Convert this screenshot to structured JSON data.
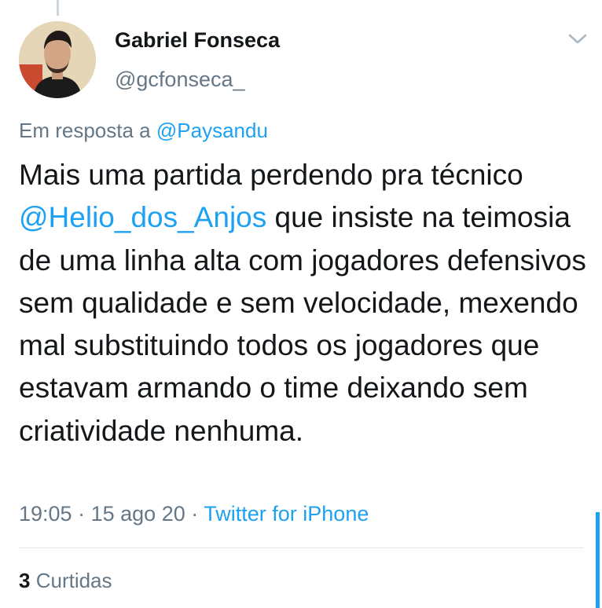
{
  "tweet": {
    "author": {
      "name": "Gabriel Fonseca",
      "handle": "@gcfonseca_"
    },
    "reply": {
      "prefix": "Em resposta a",
      "mention": "@Paysandu"
    },
    "body": {
      "part1": "Mais uma partida perdendo pra técnico",
      "mention": "@Helio_dos_Anjos",
      "part2": "que insiste na teimosia de uma linha alta com jogadores defensivos sem qualidade e sem velocidade, mexendo mal substituindo todos os jogadores que estavam armando o time deixando sem criatividade nenhuma."
    },
    "meta": {
      "time": "19:05",
      "separator": "·",
      "date": "15 ago 20",
      "source": "Twitter for iPhone"
    },
    "likes": {
      "count": "3",
      "label": "Curtidas"
    }
  },
  "icons": {
    "menu": "chevron-down-icon",
    "avatar": "profile-photo"
  },
  "colors": {
    "link": "#1da1f2",
    "secondary_text": "#657786",
    "primary_text": "#14171a",
    "divider": "#e1e8ed"
  }
}
